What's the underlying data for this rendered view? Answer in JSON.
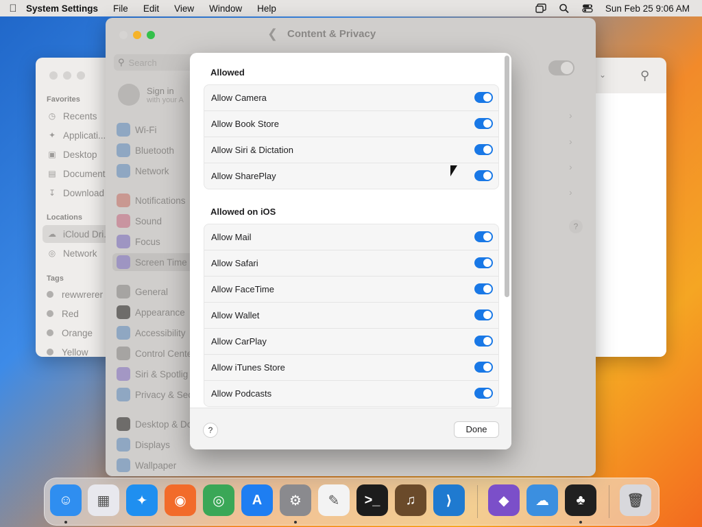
{
  "menubar": {
    "app_name": "System Settings",
    "menus": [
      "File",
      "Edit",
      "View",
      "Window",
      "Help"
    ],
    "clock": "Sun Feb 25  9:06 AM"
  },
  "finder": {
    "favorites_label": "Favorites",
    "favorites": [
      "Recents",
      "Applicati...",
      "Desktop",
      "Document",
      "Download"
    ],
    "locations_label": "Locations",
    "locations": [
      "iCloud Dri...",
      "Network"
    ],
    "tags_label": "Tags",
    "tags": [
      {
        "label": "rewwrerer",
        "color": "#a9a7a5"
      },
      {
        "label": "Red",
        "color": "#a9a7a5"
      },
      {
        "label": "Orange",
        "color": "#a9a7a5"
      },
      {
        "label": "Yellow",
        "color": "#a9a7a5"
      }
    ]
  },
  "settings": {
    "title": "Content & Privacy",
    "search_placeholder": "Search",
    "signin_title": "Sign in",
    "signin_sub": "with your A",
    "sidebar": [
      {
        "label": "Wi-Fi",
        "icon": "wifi-icon",
        "color": "#8fa7c2"
      },
      {
        "label": "Bluetooth",
        "icon": "bluetooth-icon",
        "color": "#8fa7c2"
      },
      {
        "label": "Network",
        "icon": "network-icon",
        "color": "#8fa7c2"
      },
      {
        "label": "Notifications",
        "icon": "bell-icon",
        "color": "#c99891"
      },
      {
        "label": "Sound",
        "icon": "speaker-icon",
        "color": "#c994a0"
      },
      {
        "label": "Focus",
        "icon": "moon-icon",
        "color": "#9e95c2"
      },
      {
        "label": "Screen Time",
        "icon": "hourglass-icon",
        "color": "#9e95c2"
      },
      {
        "label": "General",
        "icon": "gear-icon",
        "color": "#a6a4a2"
      },
      {
        "label": "Appearance",
        "icon": "appearance-icon",
        "color": "#6e6c6a"
      },
      {
        "label": "Accessibility",
        "icon": "accessibility-icon",
        "color": "#8fa7c2"
      },
      {
        "label": "Control Cente",
        "icon": "control-center-icon",
        "color": "#a6a4a2"
      },
      {
        "label": "Siri & Spotlig",
        "icon": "siri-icon",
        "color": "#a397c4"
      },
      {
        "label": "Privacy & Sec",
        "icon": "hand-icon",
        "color": "#8fa7c2"
      },
      {
        "label": "Desktop & Do",
        "icon": "desktop-icon",
        "color": "#6e6c6a"
      },
      {
        "label": "Displays",
        "icon": "display-icon",
        "color": "#8fa7c2"
      },
      {
        "label": "Wallpaper",
        "icon": "wallpaper-icon",
        "color": "#8fa7c2"
      }
    ]
  },
  "sheet": {
    "allowed_header": "Allowed",
    "allowed": [
      {
        "label": "Allow Camera",
        "on": true
      },
      {
        "label": "Allow Book Store",
        "on": true
      },
      {
        "label": "Allow Siri & Dictation",
        "on": true
      },
      {
        "label": "Allow SharePlay",
        "on": true
      }
    ],
    "ios_header": "Allowed on iOS",
    "ios": [
      {
        "label": "Allow Mail",
        "on": true
      },
      {
        "label": "Allow Safari",
        "on": true
      },
      {
        "label": "Allow FaceTime",
        "on": true
      },
      {
        "label": "Allow Wallet",
        "on": true
      },
      {
        "label": "Allow CarPlay",
        "on": true
      },
      {
        "label": "Allow iTunes Store",
        "on": true
      },
      {
        "label": "Allow Podcasts",
        "on": true
      }
    ],
    "help_label": "?",
    "done_label": "Done",
    "accent": "#1978e6"
  },
  "dock": [
    {
      "name": "finder-icon",
      "color": "#2f8ef0",
      "glyph": "☺",
      "dot": true
    },
    {
      "name": "launchpad-icon",
      "color": "#e8e8ee",
      "glyph": "▦",
      "dot": false
    },
    {
      "name": "safari-icon",
      "color": "#1f8ff0",
      "glyph": "✦",
      "dot": false
    },
    {
      "name": "firefox-icon",
      "color": "#f26b2a",
      "glyph": "◉",
      "dot": false
    },
    {
      "name": "chrome-icon",
      "color": "#3aa757",
      "glyph": "◎",
      "dot": false
    },
    {
      "name": "app-store-icon",
      "color": "#1e7ef2",
      "glyph": "A",
      "dot": false
    },
    {
      "name": "system-settings-icon",
      "color": "#8a8a8e",
      "glyph": "⚙",
      "dot": true
    },
    {
      "name": "textedit-icon",
      "color": "#f3f3f3",
      "glyph": "✎",
      "dot": false
    },
    {
      "name": "terminal-icon",
      "color": "#1c1c1c",
      "glyph": ">_",
      "dot": false
    },
    {
      "name": "garageband-icon",
      "color": "#6a4a2a",
      "glyph": "♫",
      "dot": false
    },
    {
      "name": "vscode-icon",
      "color": "#1f7ad0",
      "glyph": "⟩",
      "dot": false
    },
    {
      "name": "visual-studio-icon",
      "color": "#7b4fc9",
      "glyph": "◆",
      "dot": false
    },
    {
      "name": "weather-icon",
      "color": "#3b8fe0",
      "glyph": "☁",
      "dot": false
    },
    {
      "name": "bartender-icon",
      "color": "#202020",
      "glyph": "♣",
      "dot": true
    },
    {
      "name": "trash-icon",
      "color": "#d8d8dc",
      "glyph": "🗑",
      "dot": false
    }
  ]
}
